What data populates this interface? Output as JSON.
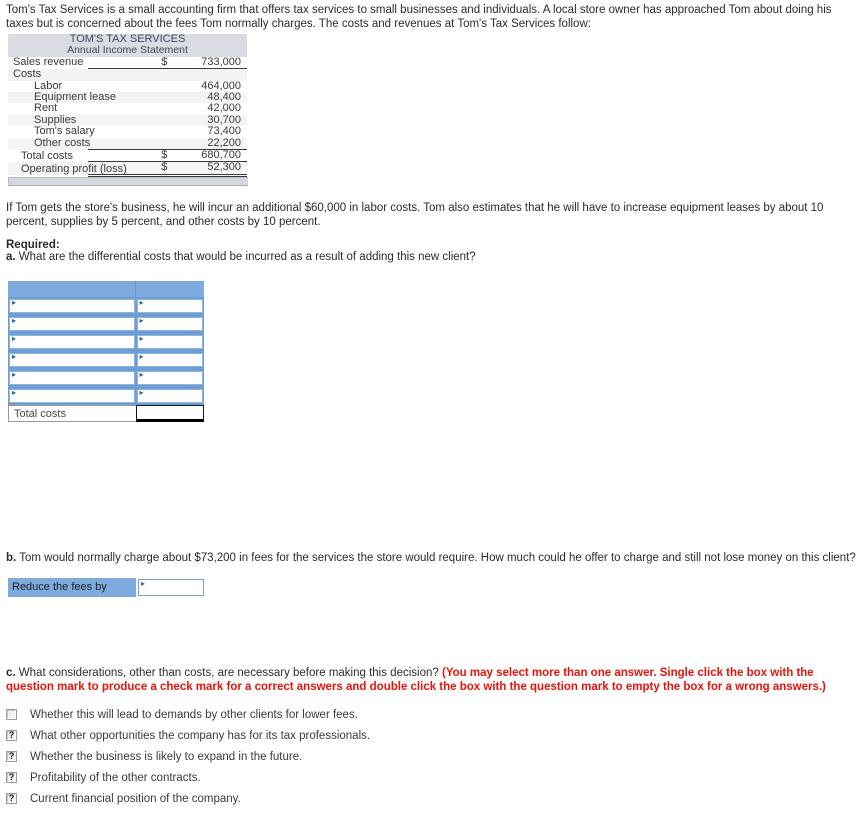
{
  "intro": {
    "paragraph": "Tom's Tax Services is a small accounting firm that offers tax services to small businesses and individuals. A local store owner has approached Tom about doing his taxes but is concerned about the fees Tom normally charges. The costs and revenues at Tom's Tax Services follow:"
  },
  "income_statement": {
    "title": "TOM'S TAX SERVICES",
    "subtitle": "Annual Income Statement",
    "rows": [
      {
        "label": "Sales revenue",
        "dollar": "$",
        "value": "733,000"
      },
      {
        "label": "Costs",
        "dollar": "",
        "value": ""
      },
      {
        "label": "Labor",
        "dollar": "",
        "value": "464,000"
      },
      {
        "label": "Equipment lease",
        "dollar": "",
        "value": "48,400"
      },
      {
        "label": "Rent",
        "dollar": "",
        "value": "42,000"
      },
      {
        "label": "Supplies",
        "dollar": "",
        "value": "30,700"
      },
      {
        "label": "Tom's salary",
        "dollar": "",
        "value": "73,400"
      },
      {
        "label": "Other costs",
        "dollar": "",
        "value": "22,200"
      },
      {
        "label": "Total costs",
        "dollar": "$",
        "value": "680,700"
      },
      {
        "label": "Operating profit (loss)",
        "dollar": "$",
        "value": "52,300"
      }
    ]
  },
  "assumptions": {
    "paragraph": "If Tom gets the store's business, he will incur an additional $60,000 in labor costs. Tom also estimates that he will have to increase equipment leases by about 10 percent, supplies by 5 percent, and other costs by 10 percent."
  },
  "required": {
    "heading": "Required:",
    "question_a_prefix": "a.",
    "question_a": "What are the differential costs that would be incurred as a result of adding this new client?"
  },
  "answer_table_a": {
    "header": {
      "col1": "",
      "col2": ""
    },
    "input_rows": [
      {
        "label": "",
        "value": ""
      },
      {
        "label": "",
        "value": ""
      },
      {
        "label": "",
        "value": ""
      },
      {
        "label": "",
        "value": ""
      },
      {
        "label": "",
        "value": ""
      },
      {
        "label": "",
        "value": ""
      }
    ],
    "total_row": {
      "label": "Total costs",
      "value": ""
    },
    "header_color": "#7eabdd",
    "caret_icon": "caret-right-icon"
  },
  "part_b": {
    "prefix": "b.",
    "question": "Tom would normally charge about $73,200 in fees for the services the store would require. How much could he offer to charge and still not lose money on this client?",
    "answer_label": "Reduce the fees by",
    "answer_value": "",
    "label_color": "#7eabdd"
  },
  "part_c": {
    "prefix": "c.",
    "question": "What considerations, other than costs, are necessary before making this decision?",
    "instruction": "(You may select more than one answer. Single click the box with the question mark to produce a check mark for a correct answers and double click the box with the question mark to empty the box for a wrong answers.)",
    "instruction_color": "#e8130b",
    "options": [
      {
        "text": "Whether this will lead to demands by other clients for lower fees.",
        "state": "blank"
      },
      {
        "text": "What other opportunities the company has for its tax professionals.",
        "state": "question"
      },
      {
        "text": "Whether the business is likely to expand in the future.",
        "state": "question"
      },
      {
        "text": "Profitability of the other contracts.",
        "state": "question"
      },
      {
        "text": "Current financial position of the company.",
        "state": "question"
      }
    ]
  }
}
